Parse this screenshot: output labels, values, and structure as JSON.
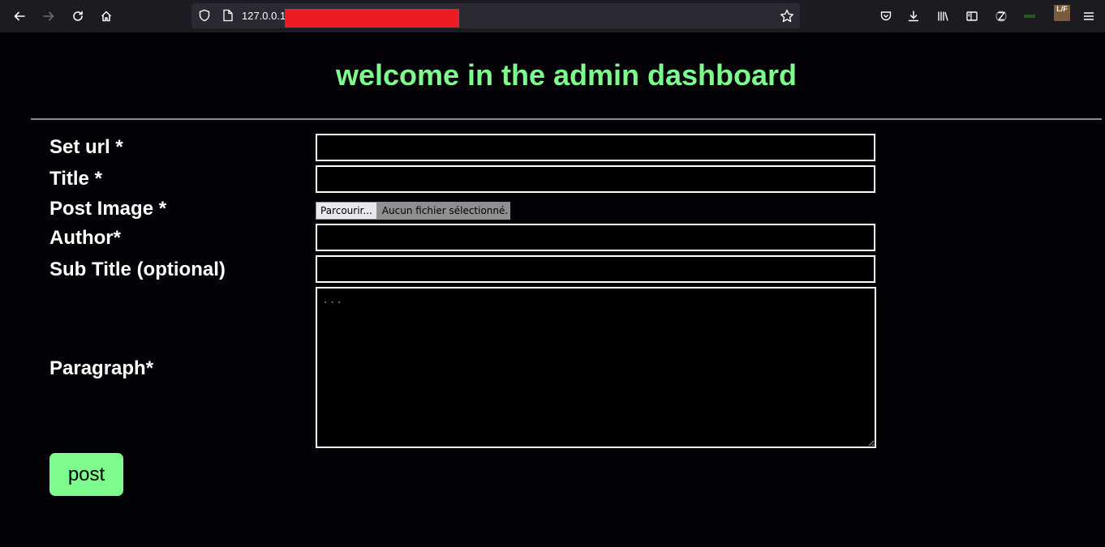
{
  "browser": {
    "url_prefix": "127.0.0.1",
    "lf_badge": "L/F"
  },
  "page": {
    "title": "welcome in the admin dashboard",
    "title_color": "#7dfb8d"
  },
  "form": {
    "url_label": "Set url *",
    "title_label": "Title *",
    "image_label": "Post Image *",
    "file_button": "Parcourir...",
    "file_status": "Aucun fichier sélectionné.",
    "author_label": "Author*",
    "subtitle_label": "Sub Title (optional)",
    "paragraph_label": "Paragraph*",
    "paragraph_placeholder": "...",
    "submit_label": "post"
  },
  "icons": [
    "back-arrow-icon",
    "forward-arrow-icon",
    "reload-icon",
    "home-icon",
    "shield-icon",
    "page-icon",
    "star-icon",
    "pocket-icon",
    "download-icon",
    "library-icon",
    "sidebar-icon",
    "translate-icon",
    "extension-icon",
    "menu-icon"
  ]
}
